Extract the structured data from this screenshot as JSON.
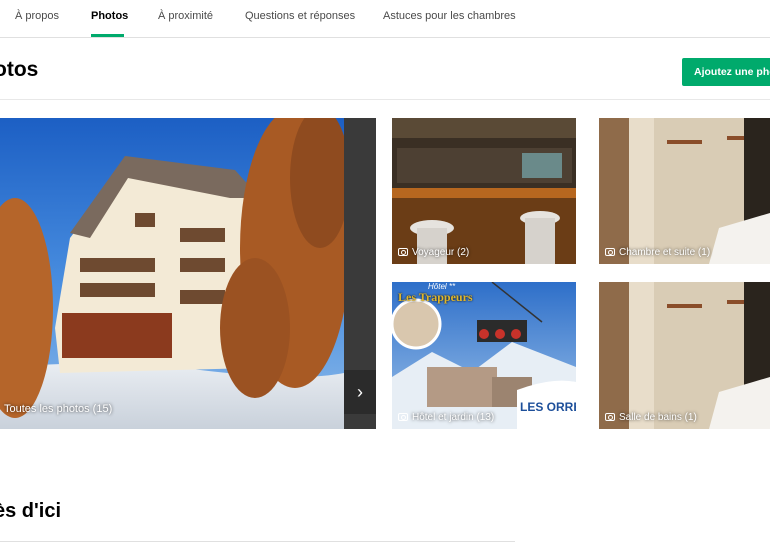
{
  "tabs": [
    {
      "label": "À propos",
      "active": false
    },
    {
      "label": "Photos",
      "active": true
    },
    {
      "label": "À proximité",
      "active": false
    },
    {
      "label": "Questions et réponses",
      "active": false
    },
    {
      "label": "Astuces pour les chambres",
      "active": false
    }
  ],
  "section": {
    "title": "otos",
    "add_photo_button": "Ajoutez une photo"
  },
  "gallery": {
    "main": {
      "caption": "Toutes les photos (15)"
    },
    "thumbnails": [
      {
        "caption": "Voyageur (2)"
      },
      {
        "caption": "Chambre et suite (1)"
      },
      {
        "caption": "Hôtel et jardin (13)"
      },
      {
        "caption": "Salle de bains (1)"
      }
    ],
    "photo_overlay_text": {
      "hotel_sign": "Les Trappeurs",
      "stars": "Hôtel **",
      "banner": "LES ORRES"
    }
  },
  "lower_section": {
    "title": "ès d'ici"
  },
  "colors": {
    "accent": "#00aa6c",
    "tab_text": "#4a4a4a",
    "divider": "#e0e0e0"
  },
  "icons": {
    "next": "chevron-right-icon",
    "camera": "camera-icon"
  }
}
